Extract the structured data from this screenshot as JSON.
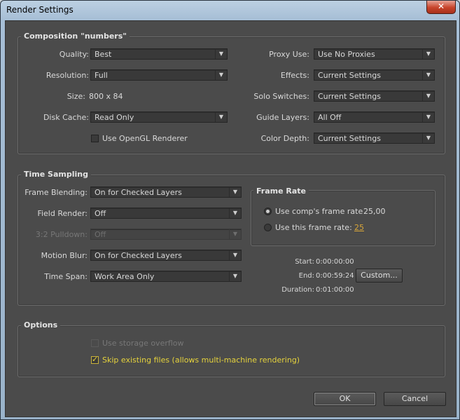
{
  "window": {
    "title": "Render Settings"
  },
  "composition": {
    "title": "Composition \"numbers\"",
    "quality": {
      "label": "Quality:",
      "value": "Best"
    },
    "resolution": {
      "label": "Resolution:",
      "value": "Full"
    },
    "size": {
      "label": "Size:",
      "value": "800 x 84"
    },
    "disk_cache": {
      "label": "Disk Cache:",
      "value": "Read Only"
    },
    "opengl": {
      "label": "Use OpenGL Renderer",
      "checked": false
    },
    "proxy_use": {
      "label": "Proxy Use:",
      "value": "Use No Proxies"
    },
    "effects": {
      "label": "Effects:",
      "value": "Current Settings"
    },
    "solo_switches": {
      "label": "Solo Switches:",
      "value": "Current Settings"
    },
    "guide_layers": {
      "label": "Guide Layers:",
      "value": "All Off"
    },
    "color_depth": {
      "label": "Color Depth:",
      "value": "Current Settings"
    }
  },
  "time_sampling": {
    "title": "Time Sampling",
    "frame_blending": {
      "label": "Frame Blending:",
      "value": "On for Checked Layers"
    },
    "field_render": {
      "label": "Field Render:",
      "value": "Off"
    },
    "pulldown": {
      "label": "3:2 Pulldown:",
      "value": "Off"
    },
    "motion_blur": {
      "label": "Motion Blur:",
      "value": "On for Checked Layers"
    },
    "time_span": {
      "label": "Time Span:",
      "value": "Work Area Only"
    },
    "frame_rate": {
      "title": "Frame Rate",
      "comp_rate": {
        "label": "Use comp's frame rate",
        "value": "25,00",
        "selected": true
      },
      "this_rate": {
        "label": "Use this frame rate:",
        "value": "25",
        "selected": false
      }
    },
    "start": {
      "label": "Start:",
      "value": "0:00:00:00"
    },
    "end": {
      "label": "End:",
      "value": "0:00:59:24"
    },
    "duration": {
      "label": "Duration:",
      "value": "0:01:00:00"
    },
    "custom_button": "Custom..."
  },
  "options": {
    "title": "Options",
    "storage_overflow": {
      "label": "Use storage overflow",
      "checked": false
    },
    "skip_existing": {
      "label": "Skip existing files (allows multi-machine rendering)",
      "checked": true
    }
  },
  "buttons": {
    "ok": "OK",
    "cancel": "Cancel"
  }
}
